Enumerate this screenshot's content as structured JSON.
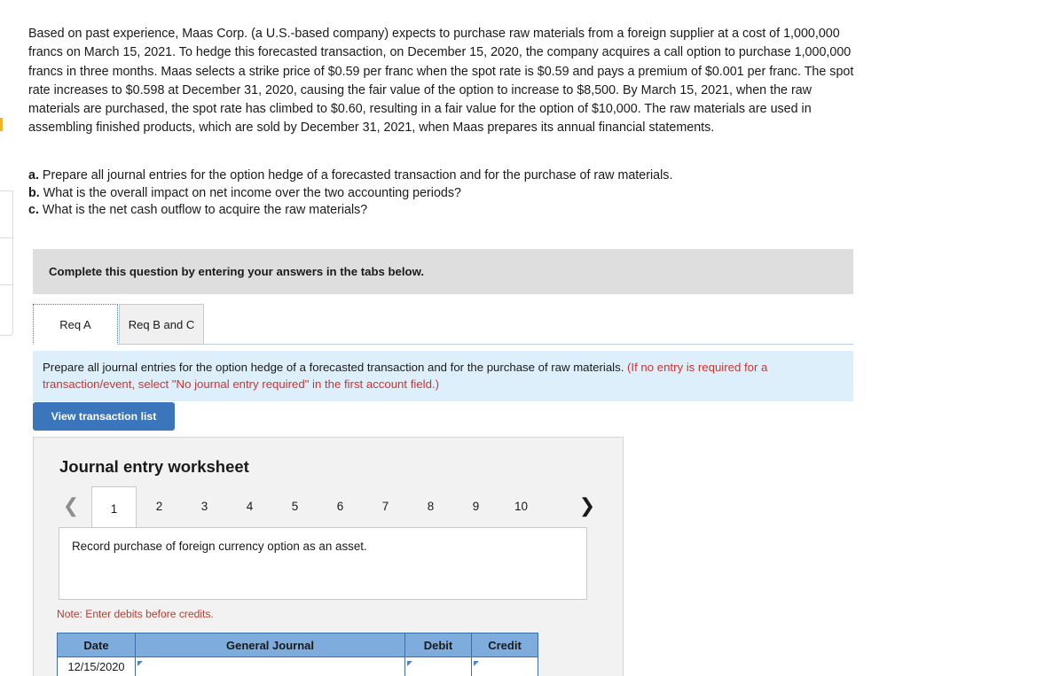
{
  "problem": {
    "statement": "Based on past experience, Maas Corp. (a U.S.-based company) expects to purchase raw materials from a foreign supplier at a cost of 1,000,000 francs on March 15, 2021. To hedge this forecasted transaction, on December 15, 2020, the company acquires a call option to purchase 1,000,000 francs in three months. Maas selects a strike price of $0.59 per franc when the spot rate is $0.59 and pays a premium of $0.001 per franc. The spot rate increases to $0.598 at December 31, 2020, causing the fair value of the option to increase to $8,500. By March 15, 2021, when the raw materials are purchased, the spot rate has climbed to $0.60, resulting in a fair value for the option of $10,000. The raw materials are used in assembling finished products, which are sold by December 31, 2021, when Maas prepares its annual financial statements.",
    "requirements": [
      {
        "label": "a.",
        "text": "Prepare all journal entries for the option hedge of a forecasted transaction and for the purchase of raw materials."
      },
      {
        "label": "b.",
        "text": "What is the overall impact on net income over the two accounting periods?"
      },
      {
        "label": "c.",
        "text": "What is the net cash outflow to acquire the raw materials?"
      }
    ]
  },
  "complete_bar": {
    "text": "Complete this question by entering your answers in the tabs below."
  },
  "tabs": [
    {
      "label": "Req A",
      "active": true
    },
    {
      "label": "Req B and C",
      "active": false
    }
  ],
  "info_banner": {
    "main": "Prepare all journal entries for the option hedge of a forecasted transaction and for the purchase of raw materials.",
    "note": "(If no entry is required for a transaction/event, select \"No journal entry required\" in the first account field.)"
  },
  "buttons": {
    "view_transaction_list": "View transaction list"
  },
  "worksheet": {
    "title": "Journal entry worksheet",
    "pager": {
      "prev_icon": "chevron-left-icon",
      "next_icon": "chevron-right-icon",
      "pages": [
        "1",
        "2",
        "3",
        "4",
        "5",
        "6",
        "7",
        "8",
        "9",
        "10"
      ],
      "active_page": "1"
    },
    "transaction_description": "Record purchase of foreign currency option as an asset.",
    "note": "Note: Enter debits before credits.",
    "table": {
      "headers": [
        "Date",
        "General Journal",
        "Debit",
        "Credit"
      ],
      "rows": [
        {
          "date": "12/15/2020",
          "account": "",
          "debit": "",
          "credit": ""
        }
      ]
    }
  },
  "colors": {
    "primary_button": "#3b76bc",
    "table_header": "#7dacdd",
    "info_banner": "#dceffa",
    "complete_bar": "#dedede",
    "note_red": "#c0392b",
    "banner_note_red": "#d0332f",
    "panel_gray": "#f2f2f2",
    "edge_mark": "#f0b323"
  }
}
